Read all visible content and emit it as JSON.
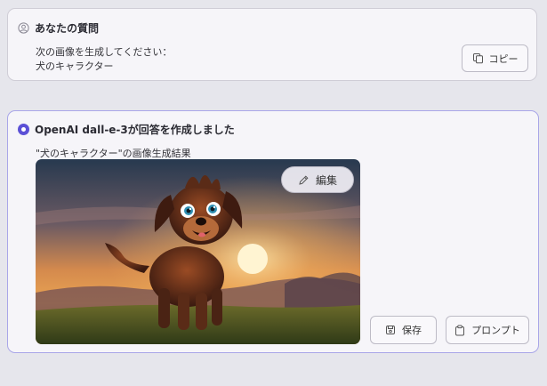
{
  "question": {
    "header": "あなたの質問",
    "line1": "次の画像を生成してください：",
    "line2": "犬のキャラクター",
    "copy_label": "コピー"
  },
  "answer": {
    "header": "OpenAI dall-e-3が回答を作成しました",
    "caption": "\"犬のキャラクター\"の画像生成結果",
    "edit_label": "編集",
    "save_label": "保存",
    "prompt_label": "プロンプト",
    "image": {
      "subject": "cartoon dog character",
      "scene": "sunset meadow"
    }
  },
  "icons": {
    "question": "user-circle-icon",
    "answer": "radio-selected-icon",
    "copy": "copy-icon",
    "edit": "pencil-icon",
    "save": "save-icon",
    "prompt": "clipboard-icon"
  },
  "colors": {
    "accent": "#5b50d6",
    "answer_border": "#a9a6e8",
    "background": "#e6e6ec"
  }
}
